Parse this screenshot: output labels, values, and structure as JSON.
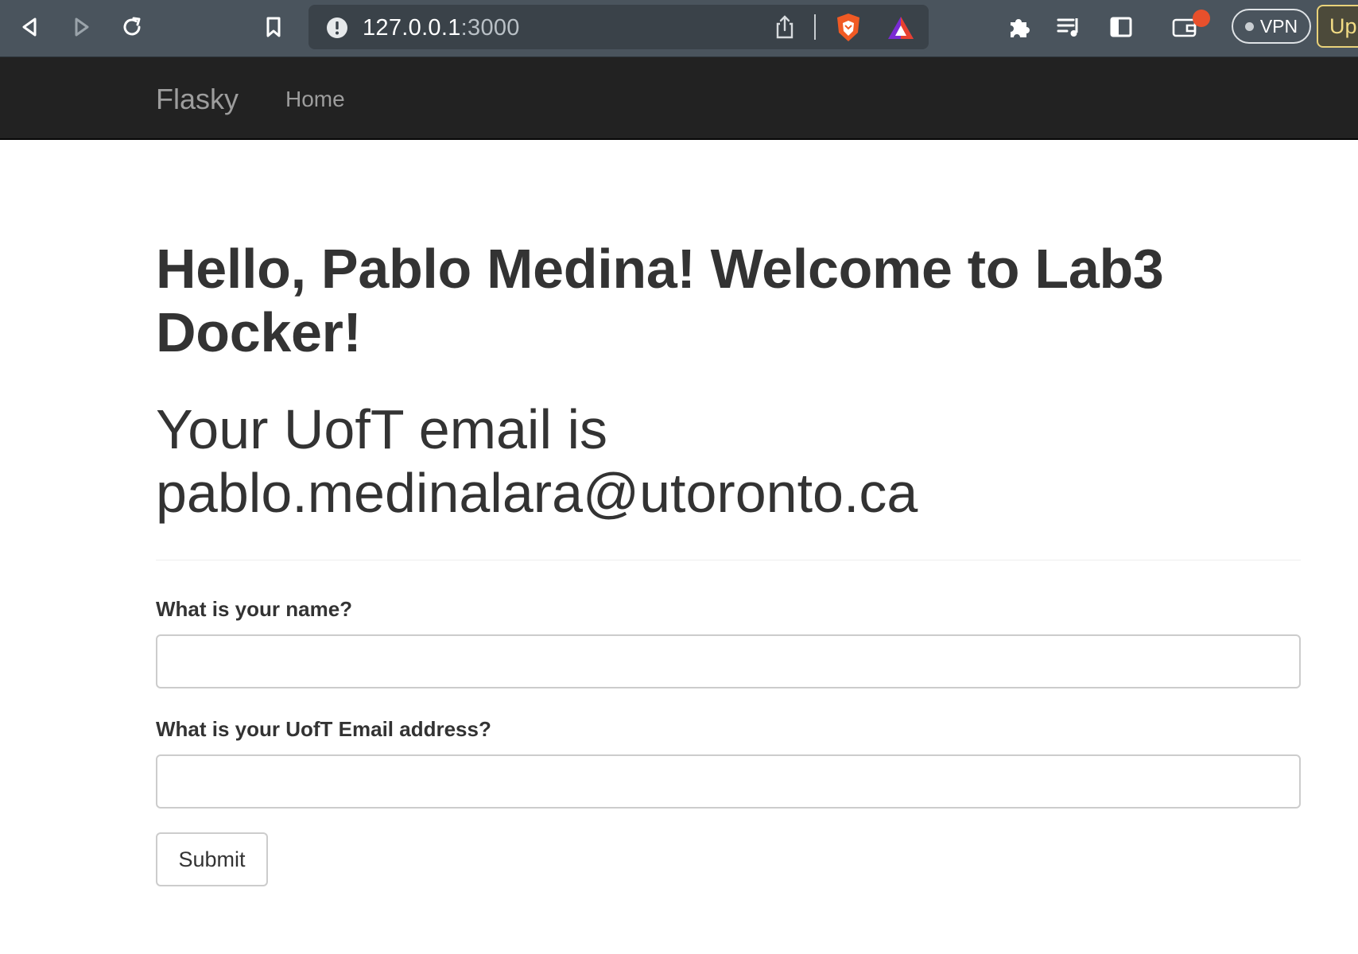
{
  "browser": {
    "url_host": "127.0.0.1",
    "url_port": ":3000",
    "vpn_label": "VPN",
    "update_label": "Up",
    "icons": [
      "back-icon",
      "forward-icon",
      "reload-icon",
      "bookmark-icon",
      "site-info-icon",
      "share-icon",
      "brave-shields-icon",
      "brave-rewards-icon",
      "extensions-icon",
      "playlist-icon",
      "sidebar-icon",
      "wallet-icon"
    ],
    "colors": {
      "chrome": "#4a545d",
      "shields": "#f05a24",
      "badge": "#e8502c"
    }
  },
  "navbar": {
    "brand": "Flasky",
    "home": "Home"
  },
  "page": {
    "greeting": "Hello, Pablo Medina! Welcome to Lab3 Docker!",
    "email_line_1": "Your UofT email is",
    "email_line_2": "pablo.medinalara@utoronto.ca"
  },
  "form": {
    "name_label": "What is your name?",
    "name_value": "",
    "email_label": "What is your UofT Email address?",
    "email_value": "",
    "submit_label": "Submit"
  }
}
